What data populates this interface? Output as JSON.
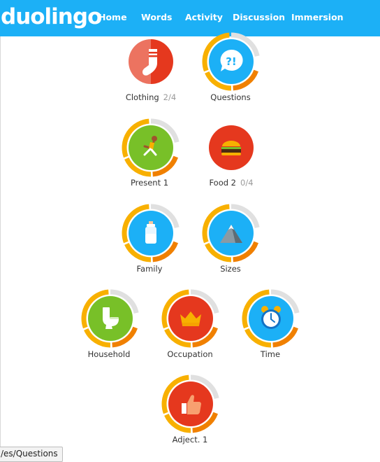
{
  "app": {
    "logo": "duolingo"
  },
  "nav": {
    "home": "Home",
    "words": "Words",
    "activity": "Activity",
    "discussion": "Discussion",
    "immersion": "Immersion"
  },
  "colors": {
    "brand": "#1cb0f6",
    "red": "#e5381e",
    "green": "#78c028",
    "blue": "#1cb0f6",
    "gold": "#f8b000",
    "orange": "#f08000",
    "gray": "#e0e0e0"
  },
  "skills": [
    {
      "name": "Clothing",
      "progress": "2/4",
      "icon": "sock-icon",
      "color": "red",
      "ring": false
    },
    {
      "name": "Questions",
      "progress": "",
      "icon": "question-bubble-icon",
      "color": "blue",
      "ring": true
    },
    {
      "name": "Present 1",
      "progress": "",
      "icon": "runner-icon",
      "color": "green",
      "ring": true
    },
    {
      "name": "Food 2",
      "progress": "0/4",
      "icon": "hamburger-icon",
      "color": "red",
      "ring": false
    },
    {
      "name": "Family",
      "progress": "",
      "icon": "baby-bottle-icon",
      "color": "blue",
      "ring": true
    },
    {
      "name": "Sizes",
      "progress": "",
      "icon": "mountain-icon",
      "color": "blue",
      "ring": true
    },
    {
      "name": "Household",
      "progress": "",
      "icon": "toilet-icon",
      "color": "green",
      "ring": true
    },
    {
      "name": "Occupation",
      "progress": "",
      "icon": "crown-icon",
      "color": "red",
      "ring": true
    },
    {
      "name": "Time",
      "progress": "",
      "icon": "alarm-clock-icon",
      "color": "blue",
      "ring": true
    },
    {
      "name": "Adject. 1",
      "progress": "",
      "icon": "thumbs-up-icon",
      "color": "red",
      "ring": true
    }
  ],
  "tooltip": "/es/Questions"
}
